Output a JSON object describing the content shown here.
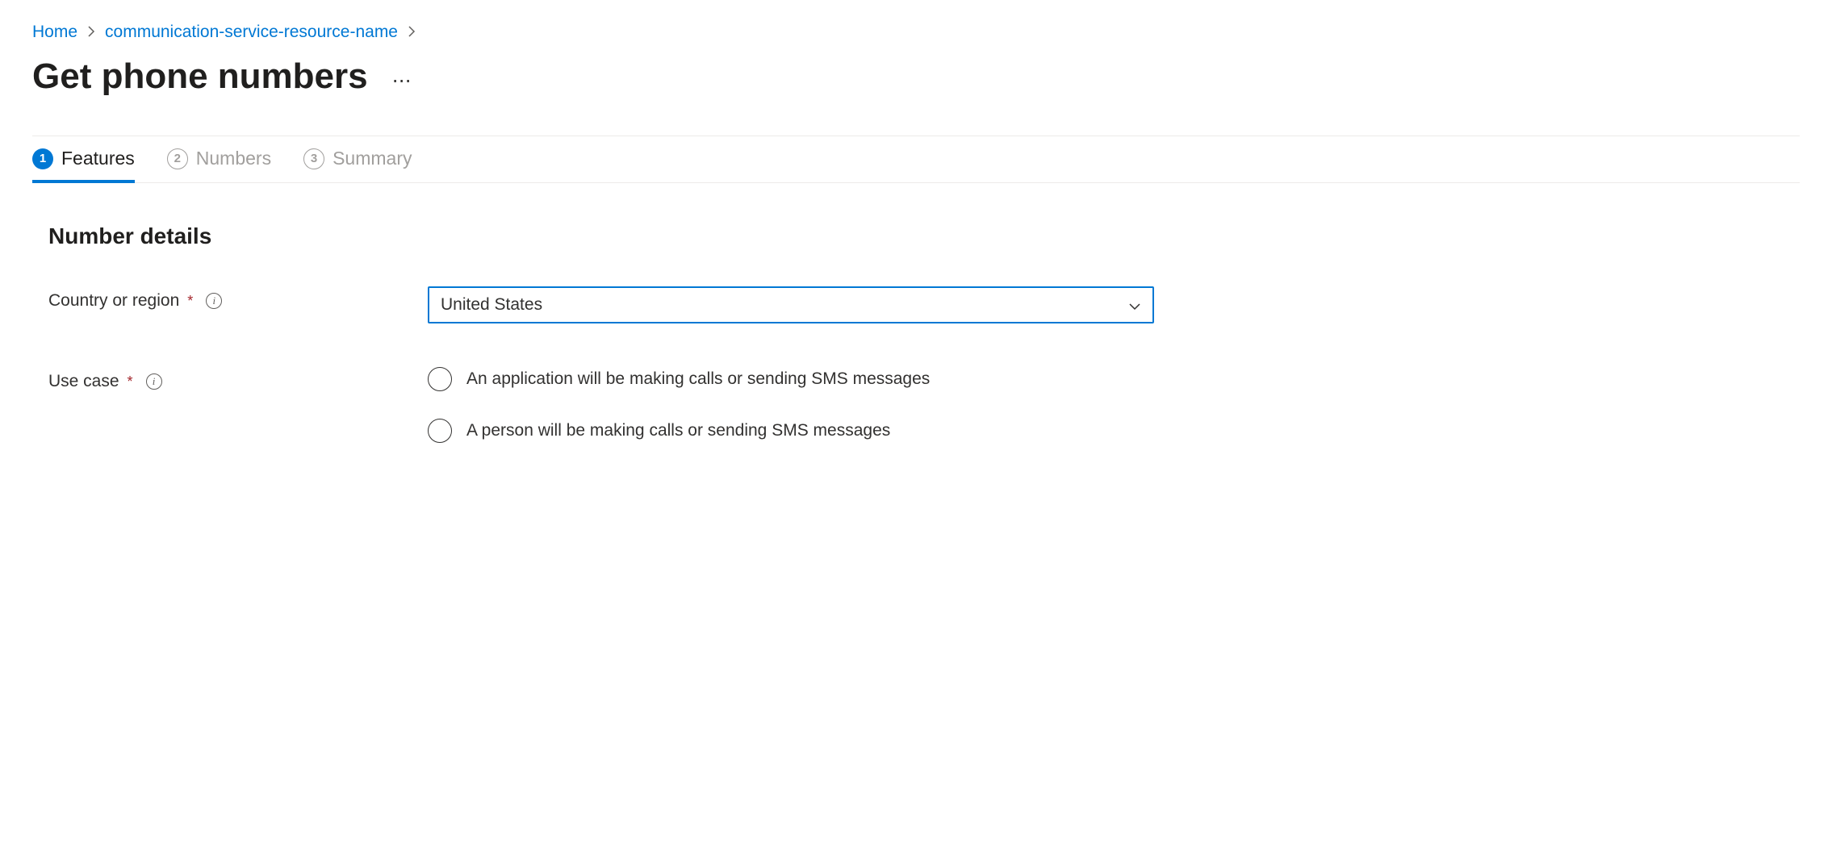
{
  "breadcrumb": {
    "home": "Home",
    "resource": "communication-service-resource-name"
  },
  "page": {
    "title": "Get phone numbers"
  },
  "tabs": [
    {
      "num": "1",
      "label": "Features",
      "active": true
    },
    {
      "num": "2",
      "label": "Numbers",
      "active": false
    },
    {
      "num": "3",
      "label": "Summary",
      "active": false
    }
  ],
  "section": {
    "title": "Number details",
    "country_label": "Country or region",
    "country_value": "United States",
    "usecase_label": "Use case",
    "radio_options": [
      "An application will be making calls or sending SMS messages",
      "A person will be making calls or sending SMS messages"
    ]
  }
}
